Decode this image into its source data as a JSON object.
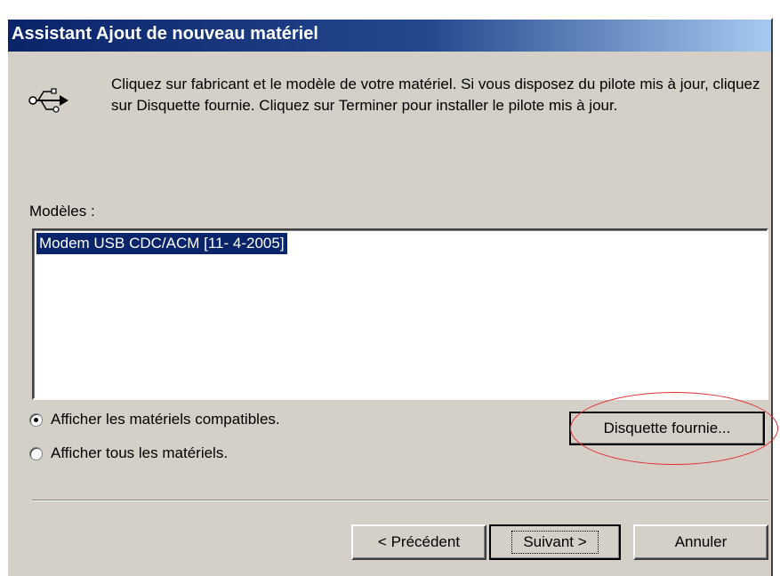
{
  "dialog": {
    "title": "Assistant Ajout de nouveau matériel",
    "instructions": "Cliquez sur fabricant et le modèle de votre matériel. Si vous disposez du pilote mis à jour, cliquez sur Disquette fournie. Cliquez sur Terminer pour installer le pilote mis à jour.",
    "icon": "usb-icon"
  },
  "models": {
    "label": "Modèles :",
    "items": [
      {
        "label": "Modem USB CDC/ACM [11- 4-2005]",
        "selected": true
      }
    ]
  },
  "options": {
    "compatible": {
      "label": "Afficher les matériels compatibles.",
      "checked": true
    },
    "all": {
      "label": "Afficher tous les matériels.",
      "checked": false
    }
  },
  "buttons": {
    "have_disk": "Disquette fournie...",
    "back": "< Précédent",
    "next": "Suivant >",
    "cancel": "Annuler"
  },
  "colors": {
    "titlebar_start": "#0a246a",
    "titlebar_end": "#a6caf0",
    "face": "#d4d0c8",
    "selection": "#0a246a",
    "annotation": "#e03030"
  }
}
